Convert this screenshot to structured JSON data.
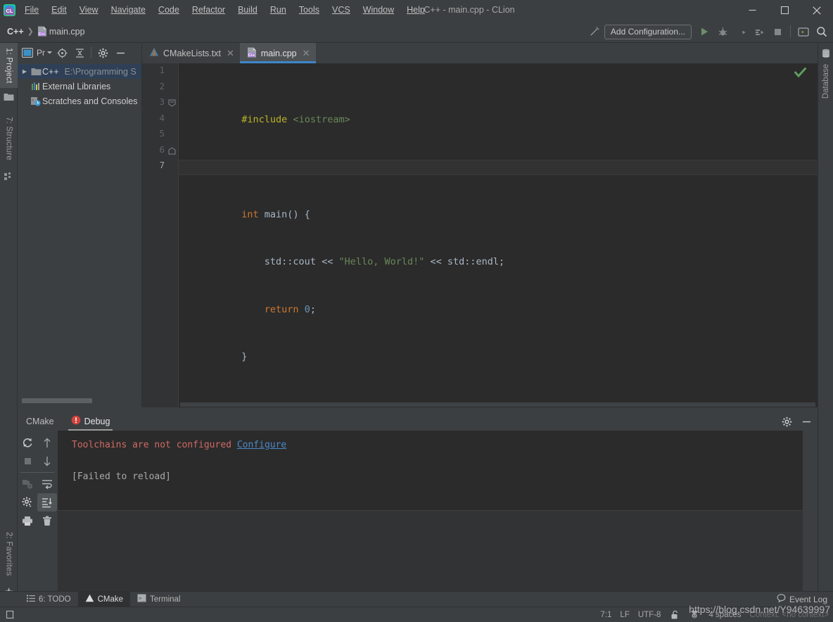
{
  "window": {
    "title": "C++ - main.cpp - CLion",
    "minimize_label": "—",
    "maximize_label": "☐",
    "close_label": "✕"
  },
  "menu": [
    {
      "label": "File",
      "mnemonic": "F"
    },
    {
      "label": "Edit",
      "mnemonic": "E"
    },
    {
      "label": "View",
      "mnemonic": "V"
    },
    {
      "label": "Navigate",
      "mnemonic": "N"
    },
    {
      "label": "Code",
      "mnemonic": "C"
    },
    {
      "label": "Refactor",
      "mnemonic": "R"
    },
    {
      "label": "Build",
      "mnemonic": "B"
    },
    {
      "label": "Run",
      "mnemonic": "n"
    },
    {
      "label": "Tools",
      "mnemonic": "T"
    },
    {
      "label": "VCS",
      "mnemonic": "S"
    },
    {
      "label": "Window",
      "mnemonic": "W"
    },
    {
      "label": "Help",
      "mnemonic": "H"
    }
  ],
  "navbar": {
    "breadcrumbs": [
      {
        "label": "C++",
        "icon": ""
      },
      {
        "label": "main.cpp",
        "icon": "cpp-file-icon"
      }
    ],
    "separator": "❯",
    "build_icon": "build-hammer-icon",
    "add_configuration_label": "Add Configuration...",
    "run_icon": "run-icon",
    "debug_icon": "debug-icon",
    "run_coverage_icon": "run-with-coverage-icon",
    "profile_icon": "profile-icon",
    "stop_icon": "stop-icon",
    "updates_icon": "updates-icon",
    "search_icon": "search-everywhere-icon"
  },
  "left_strip": {
    "tabs": [
      {
        "label": "1: Project",
        "mnemonic": "1",
        "icon": "project-folder-icon",
        "active": true
      },
      {
        "label": "7: Structure",
        "mnemonic": "7",
        "icon": "structure-icon",
        "active": false
      }
    ],
    "bottom_tabs": [
      {
        "label": "2: Favorites",
        "mnemonic": "2",
        "icon": "star-icon",
        "active": false
      }
    ]
  },
  "right_strip": {
    "tabs": [
      {
        "label": "Database",
        "icon": "database-icon",
        "active": false
      }
    ]
  },
  "project_panel": {
    "header": {
      "view_icon": "project-view-icon",
      "view_label": "Pr",
      "dropdown_icon": "chevron-down-icon",
      "locate_icon": "select-opened-file-icon",
      "collapse_icon": "collapse-all-icon",
      "settings_icon": "gear-icon",
      "hide_icon": "hide-icon"
    },
    "tree": [
      {
        "label": "C++",
        "path": "E:\\Programming S",
        "icon": "folder-icon",
        "arrow": "▶",
        "selected": true,
        "indent": 0
      },
      {
        "label": "External Libraries",
        "path": "",
        "icon": "external-libraries-icon",
        "arrow": "",
        "selected": false,
        "indent": 1
      },
      {
        "label": "Scratches and Consoles",
        "path": "",
        "icon": "scratches-icon",
        "arrow": "",
        "selected": false,
        "indent": 1
      }
    ]
  },
  "editor": {
    "tabs": [
      {
        "label": "CMakeLists.txt",
        "icon": "cmake-icon",
        "active": false,
        "close_icon": "✕"
      },
      {
        "label": "main.cpp",
        "icon": "cpp-file-icon",
        "active": true,
        "close_icon": "✕"
      }
    ],
    "inspection_status_icon": "inspection-ok-checkmark",
    "line_count": 7,
    "current_line": 7,
    "lines": [
      {
        "num": "1",
        "fold": "",
        "tokens": [
          {
            "t": "#include",
            "c": "k-pp"
          },
          {
            "t": " ",
            "c": "k-txt"
          },
          {
            "t": "<iostream>",
            "c": "k-hdr"
          }
        ]
      },
      {
        "num": "2",
        "fold": "",
        "tokens": []
      },
      {
        "num": "3",
        "fold": "minus",
        "tokens": [
          {
            "t": "int",
            "c": "k-key"
          },
          {
            "t": " main() {",
            "c": "k-txt"
          }
        ]
      },
      {
        "num": "4",
        "fold": "",
        "tokens": [
          {
            "t": "    std::cout << ",
            "c": "k-txt"
          },
          {
            "t": "\"Hello, World!\"",
            "c": "k-str"
          },
          {
            "t": " << std::endl;",
            "c": "k-txt"
          }
        ]
      },
      {
        "num": "5",
        "fold": "",
        "tokens": [
          {
            "t": "    ",
            "c": "k-txt"
          },
          {
            "t": "return",
            "c": "k-key"
          },
          {
            "t": " ",
            "c": "k-txt"
          },
          {
            "t": "0",
            "c": "k-num"
          },
          {
            "t": ";",
            "c": "k-txt"
          }
        ]
      },
      {
        "num": "6",
        "fold": "end",
        "tokens": [
          {
            "t": "}",
            "c": "k-txt"
          }
        ]
      },
      {
        "num": "7",
        "fold": "",
        "tokens": []
      }
    ]
  },
  "bottom_panel": {
    "tabs": [
      {
        "label": "CMake",
        "icon": "",
        "active": false
      },
      {
        "label": "Debug",
        "icon": "error-circle-icon",
        "active": true
      }
    ],
    "header_icons": [
      {
        "name": "gear-icon"
      },
      {
        "name": "hide-icon"
      }
    ],
    "tools": [
      {
        "name": "rerun-cmake-icon",
        "enabled": true,
        "active": false
      },
      {
        "name": "scroll-up-icon",
        "enabled": true,
        "active": false
      },
      {
        "name": "stop-icon",
        "enabled": false,
        "active": false
      },
      {
        "name": "scroll-down-icon",
        "enabled": true,
        "active": false
      },
      {
        "name": "toggle-tasks-icon",
        "enabled": false,
        "active": false
      },
      {
        "name": "soft-wrap-icon",
        "enabled": true,
        "active": false
      },
      {
        "name": "settings-gear-icon",
        "enabled": true,
        "active": false
      },
      {
        "name": "scroll-to-end-icon",
        "enabled": true,
        "active": true
      },
      {
        "name": "print-icon",
        "enabled": true,
        "active": false
      },
      {
        "name": "clear-all-trash-icon",
        "enabled": true,
        "active": false
      }
    ],
    "console": {
      "error_text": "Toolchains are not configured",
      "link_text": "Configure",
      "status_text": "[Failed to reload]"
    }
  },
  "tool_window_bar": {
    "tabs": [
      {
        "label": "6: TODO",
        "mnemonic": "6",
        "icon": "todo-list-icon",
        "active": false
      },
      {
        "label": "CMake",
        "mnemonic": "",
        "icon": "cmake-warning-icon",
        "active": true
      },
      {
        "label": "Terminal",
        "mnemonic": "",
        "icon": "terminal-icon",
        "active": false
      }
    ],
    "event_log_label": "Event Log",
    "event_log_icon": "event-log-balloon-icon"
  },
  "status_bar": {
    "toggle_icon": "show-toolwindow-bars-icon",
    "caret_position": "7:1",
    "line_separator": "LF",
    "encoding": "UTF-8",
    "lock_icon": "unlocked-icon",
    "inspection_icon": "hector-inspections-icon",
    "indent": "4 spaces",
    "context": "Context: <no context>"
  },
  "watermark": {
    "text": "https://blog.csdn.net/Y94639997"
  },
  "colors": {
    "accent_blue": "#3d86c9",
    "error_red": "#cf6a65",
    "link_blue": "#4a88c7",
    "panel_bg": "#3c3f41",
    "editor_bg": "#2b2b2b",
    "selection_navy": "#2f4056"
  }
}
